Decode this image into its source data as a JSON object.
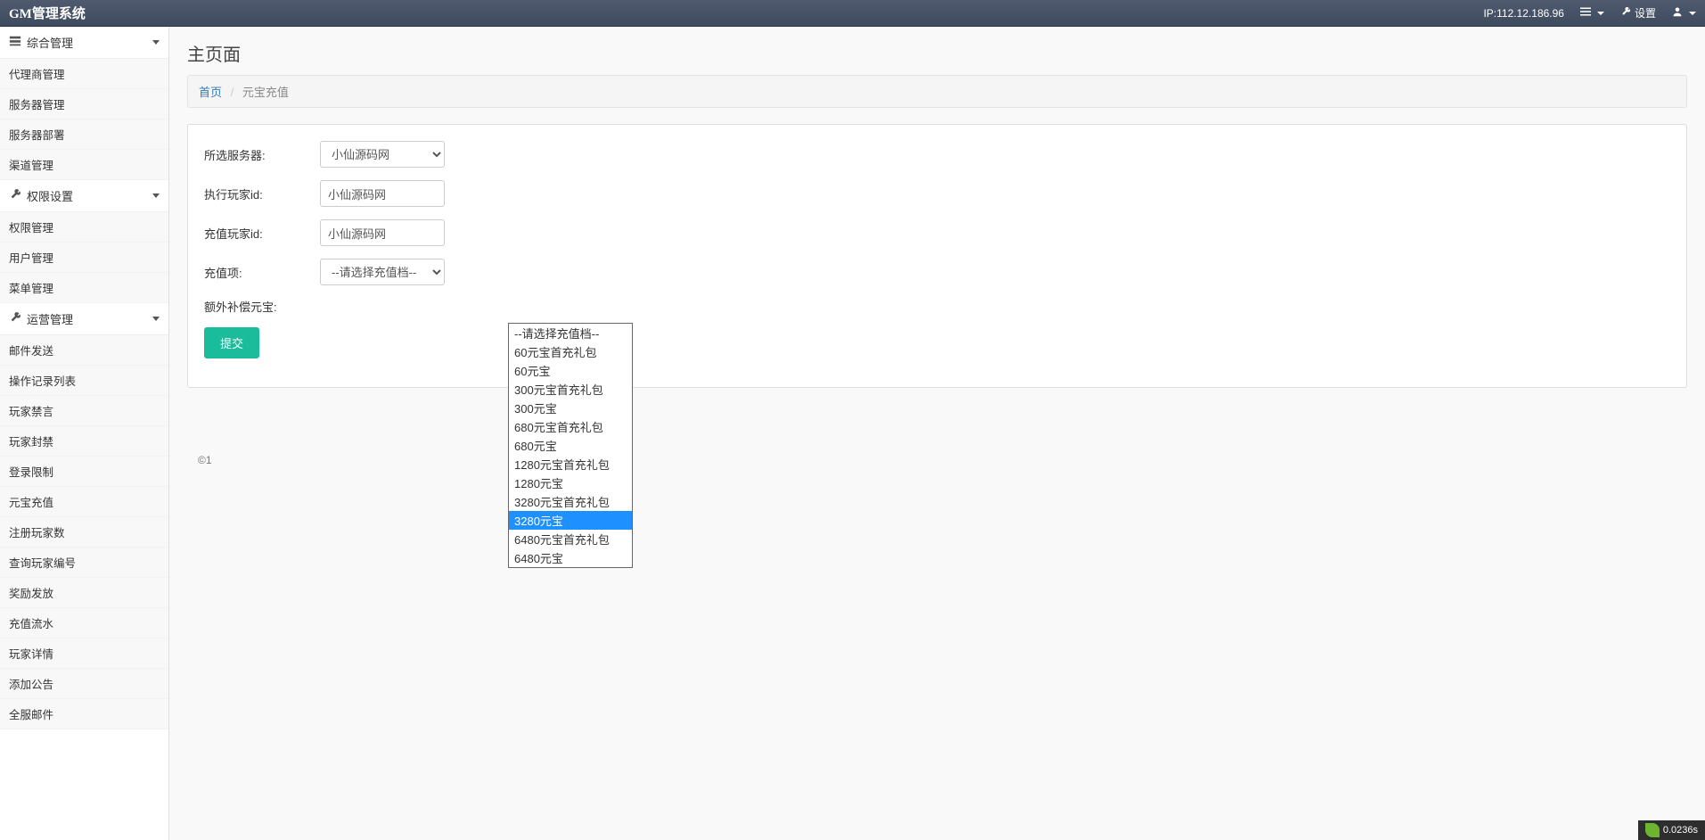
{
  "topbar": {
    "brand": "GM管理系统",
    "ip_label": "IP:112.12.186.96",
    "settings_label": "设置"
  },
  "sidebar": {
    "groups": [
      {
        "title": "综合管理",
        "items": [
          "代理商管理",
          "服务器管理",
          "服务器部署",
          "渠道管理"
        ]
      },
      {
        "title": "权限设置",
        "items": [
          "权限管理",
          "用户管理",
          "菜单管理"
        ]
      },
      {
        "title": "运营管理",
        "items": [
          "邮件发送",
          "操作记录列表",
          "玩家禁言",
          "玩家封禁",
          "登录限制",
          "元宝充值",
          "注册玩家数",
          "查询玩家编号",
          "奖励发放",
          "充值流水",
          "玩家详情",
          "添加公告",
          "全服邮件"
        ]
      }
    ]
  },
  "page": {
    "title": "主页面",
    "breadcrumb_home": "首页",
    "breadcrumb_current": "元宝充值"
  },
  "form": {
    "server_label": "所选服务器:",
    "server_value": "小仙源码网",
    "exec_player_label": "执行玩家id:",
    "exec_player_value": "小仙源码网",
    "recharge_player_label": "充值玩家id:",
    "recharge_player_value": "小仙源码网",
    "recharge_item_label": "充值项:",
    "recharge_item_selected": "--请选择充值档--",
    "extra_label": "额外补偿元宝:",
    "submit_label": "提交",
    "dropdown_options": [
      "--请选择充值档--",
      "60元宝首充礼包",
      "60元宝",
      "300元宝首充礼包",
      "300元宝",
      "680元宝首充礼包",
      "680元宝",
      "1280元宝首充礼包",
      "1280元宝",
      "3280元宝首充礼包",
      "3280元宝",
      "6480元宝首充礼包",
      "6480元宝"
    ],
    "dropdown_highlight_index": 10
  },
  "footer": {
    "copyright": "©1"
  },
  "perf": {
    "time": "0.0236s"
  }
}
